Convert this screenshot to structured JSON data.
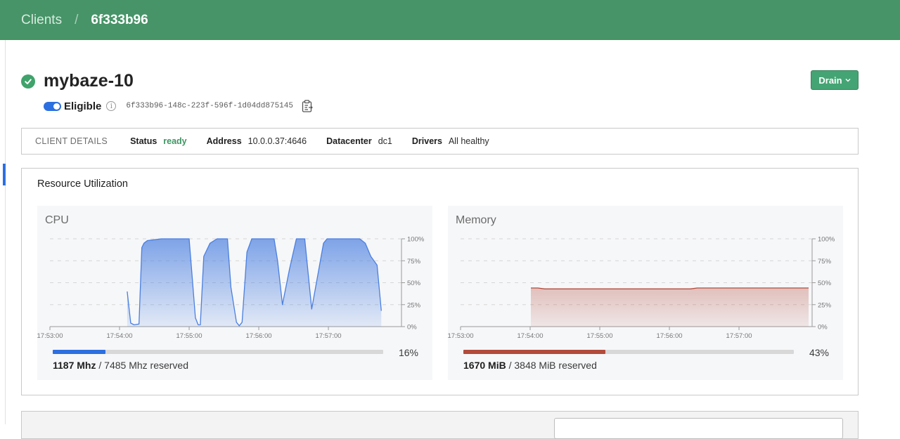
{
  "breadcrumb": {
    "parent": "Clients",
    "separator": "/",
    "current": "6f333b96"
  },
  "client": {
    "name": "mybaze-10",
    "eligible_label": "Eligible",
    "id": "6f333b96-148c-223f-596f-1d04dd875145"
  },
  "actions": {
    "drain_label": "Drain"
  },
  "details": {
    "heading": "CLIENT DETAILS",
    "status_label": "Status",
    "status_value": "ready",
    "address_label": "Address",
    "address_value": "10.0.0.37:4646",
    "datacenter_label": "Datacenter",
    "datacenter_value": "dc1",
    "drivers_label": "Drivers",
    "drivers_value": "All healthy"
  },
  "utilization": {
    "title": "Resource Utilization"
  },
  "chart_data": [
    {
      "type": "area",
      "title": "CPU",
      "ylim": [
        0,
        1
      ],
      "y_ticks": [
        "100%",
        "75%",
        "50%",
        "25%",
        "0%"
      ],
      "x_ticks": [
        "17:53:00",
        "17:54:00",
        "17:55:00",
        "17:56:00",
        "17:57:00"
      ],
      "x_range_minutes": [
        0,
        5.05
      ],
      "grid": true,
      "color": "#4a7fe0",
      "series": [
        {
          "x": [
            1.11,
            1.16,
            1.21,
            1.28,
            1.32,
            1.35,
            1.4,
            1.5,
            1.6,
            1.7,
            1.8,
            1.9,
            2.0,
            2.03,
            2.09,
            2.13,
            2.16,
            2.21,
            2.3,
            2.4,
            2.5,
            2.55,
            2.6,
            2.68,
            2.72,
            2.76,
            2.83,
            2.9,
            3.1,
            3.22,
            3.27,
            3.34,
            3.44,
            3.54,
            3.58,
            3.66,
            3.76,
            3.93,
            3.98,
            4.03,
            4.14,
            4.3,
            4.45,
            4.53,
            4.61,
            4.7,
            4.76
          ],
          "y": [
            0.4,
            0.04,
            0.02,
            0.03,
            0.9,
            0.95,
            0.98,
            0.99,
            1.0,
            1.0,
            1.0,
            1.0,
            1.0,
            0.7,
            0.1,
            0.02,
            0.02,
            0.8,
            0.95,
            1.0,
            1.0,
            1.0,
            0.45,
            0.05,
            0.01,
            0.05,
            0.85,
            1.0,
            1.0,
            1.0,
            0.75,
            0.25,
            0.65,
            1.0,
            1.0,
            1.0,
            0.2,
            0.95,
            1.0,
            1.0,
            1.0,
            1.0,
            1.0,
            0.95,
            0.8,
            0.7,
            0.18
          ]
        }
      ],
      "allocated": "1187 Mhz",
      "reserved": "/ 7485 Mhz reserved",
      "percent": 0.16,
      "percent_label": "16%"
    },
    {
      "type": "area",
      "title": "Memory",
      "ylim": [
        0,
        1
      ],
      "y_ticks": [
        "100%",
        "75%",
        "50%",
        "25%",
        "0%"
      ],
      "x_ticks": [
        "17:53:00",
        "17:54:00",
        "17:55:00",
        "17:56:00",
        "17:57:00"
      ],
      "x_range_minutes": [
        0,
        5.05
      ],
      "grid": true,
      "color": "#b24b3b",
      "series": [
        {
          "x": [
            1.01,
            1.11,
            1.21,
            2.0,
            3.0,
            3.3,
            3.4,
            4.0,
            5.0
          ],
          "y": [
            0.44,
            0.44,
            0.43,
            0.43,
            0.43,
            0.43,
            0.44,
            0.44,
            0.44
          ]
        }
      ],
      "allocated": "1670 MiB",
      "reserved": "/ 3848 MiB reserved",
      "percent": 0.43,
      "percent_label": "43%"
    }
  ],
  "icons": {
    "status": "check-circle-icon",
    "info": "info-icon",
    "copy": "clipboard-copy-icon",
    "chevron": "chevron-down-icon"
  },
  "colors": {
    "header": "#469467",
    "accent": "#2c6fe0",
    "ok": "#3fa36b",
    "cpu": "#4a7fe0",
    "memory": "#b24b3b"
  }
}
